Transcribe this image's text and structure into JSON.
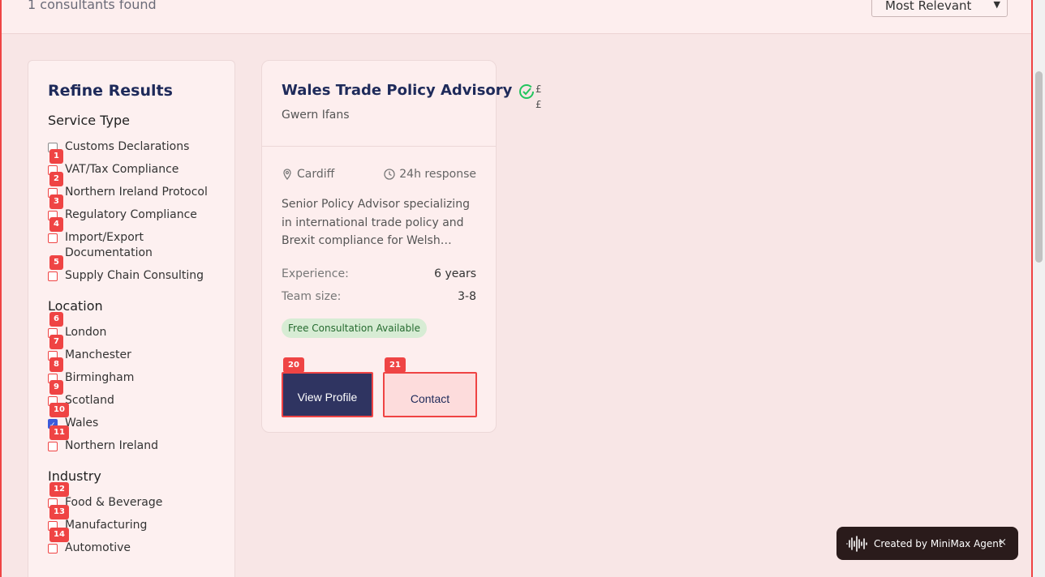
{
  "results": {
    "count_text": "1 consultants found",
    "sort_value": "Most Relevant"
  },
  "sidebar": {
    "title": "Refine Results",
    "groups": [
      {
        "title": "Service Type",
        "options": [
          {
            "label": "Customs Declarations",
            "checked": false,
            "tag": ""
          },
          {
            "label": "VAT/Tax Compliance",
            "checked": false,
            "tag": "1"
          },
          {
            "label": "Northern Ireland Protocol",
            "checked": false,
            "tag": "2"
          },
          {
            "label": "Regulatory Compliance",
            "checked": false,
            "tag": "3"
          },
          {
            "label": "Import/Export Documentation",
            "checked": false,
            "tag": "4"
          },
          {
            "label": "Supply Chain Consulting",
            "checked": false,
            "tag": "5"
          }
        ]
      },
      {
        "title": "Location",
        "options": [
          {
            "label": "London",
            "checked": false,
            "tag": "6"
          },
          {
            "label": "Manchester",
            "checked": false,
            "tag": "7"
          },
          {
            "label": "Birmingham",
            "checked": false,
            "tag": "8"
          },
          {
            "label": "Scotland",
            "checked": false,
            "tag": "9"
          },
          {
            "label": "Wales",
            "checked": true,
            "tag": "10"
          },
          {
            "label": "Northern Ireland",
            "checked": false,
            "tag": "11"
          }
        ]
      },
      {
        "title": "Industry",
        "options": [
          {
            "label": "Food & Beverage",
            "checked": false,
            "tag": "12"
          },
          {
            "label": "Manufacturing",
            "checked": false,
            "tag": "13"
          },
          {
            "label": "Automotive",
            "checked": false,
            "tag": "14"
          }
        ]
      }
    ]
  },
  "card": {
    "title": "Wales Trade Policy Advisory",
    "price": "£\n£",
    "person": "Gwern Ifans",
    "location": "Cardiff",
    "response": "24h response",
    "description": "Senior Policy Advisor specializing in international trade policy and Brexit compliance for Welsh…",
    "experience_label": "Experience:",
    "experience_value": "6 years",
    "team_label": "Team size:",
    "team_value": "3-8",
    "badge": "Free Consultation Available",
    "view_label": "View Profile",
    "view_tag": "20",
    "contact_label": "Contact",
    "contact_tag": "21"
  },
  "toast": {
    "text": "Created by MiniMax Agent",
    "close": "×"
  },
  "colors": {
    "accent": "#ef4444",
    "title": "#1e2a5a",
    "primary_button": "#2f3461",
    "badge_bg": "#d7ecd4",
    "verified": "#22c55e"
  },
  "icons": {
    "verified": "check-circle-icon",
    "location": "map-pin-icon",
    "response": "clock-icon",
    "toast": "waveform-icon",
    "sort": "chevron-down-icon"
  }
}
